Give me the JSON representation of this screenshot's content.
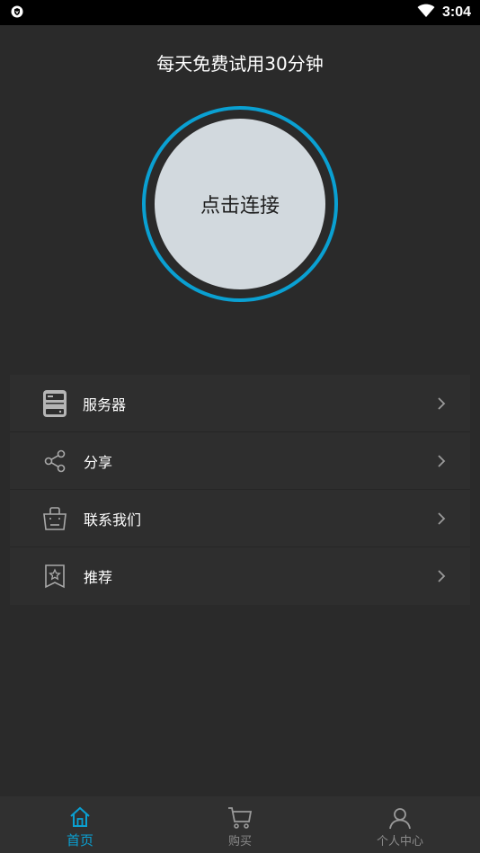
{
  "status_bar": {
    "time": "3:04",
    "icons": [
      "shield-icon",
      "wifi-icon"
    ]
  },
  "header": {
    "trial_text": "每天免费试用30分钟"
  },
  "connect": {
    "label": "点击连接",
    "ring_color": "#0aa0d2"
  },
  "menu": {
    "items": [
      {
        "label": "服务器",
        "icon": "server-icon"
      },
      {
        "label": "分享",
        "icon": "share-icon"
      },
      {
        "label": "联系我们",
        "icon": "contact-bag-icon"
      },
      {
        "label": "推荐",
        "icon": "star-bookmark-icon"
      }
    ]
  },
  "bottom_nav": {
    "items": [
      {
        "label": "首页",
        "icon": "home-icon",
        "active": true
      },
      {
        "label": "购买",
        "icon": "cart-icon",
        "active": false
      },
      {
        "label": "个人中心",
        "icon": "user-icon",
        "active": false
      }
    ],
    "accent_color": "#0aa0d2"
  }
}
